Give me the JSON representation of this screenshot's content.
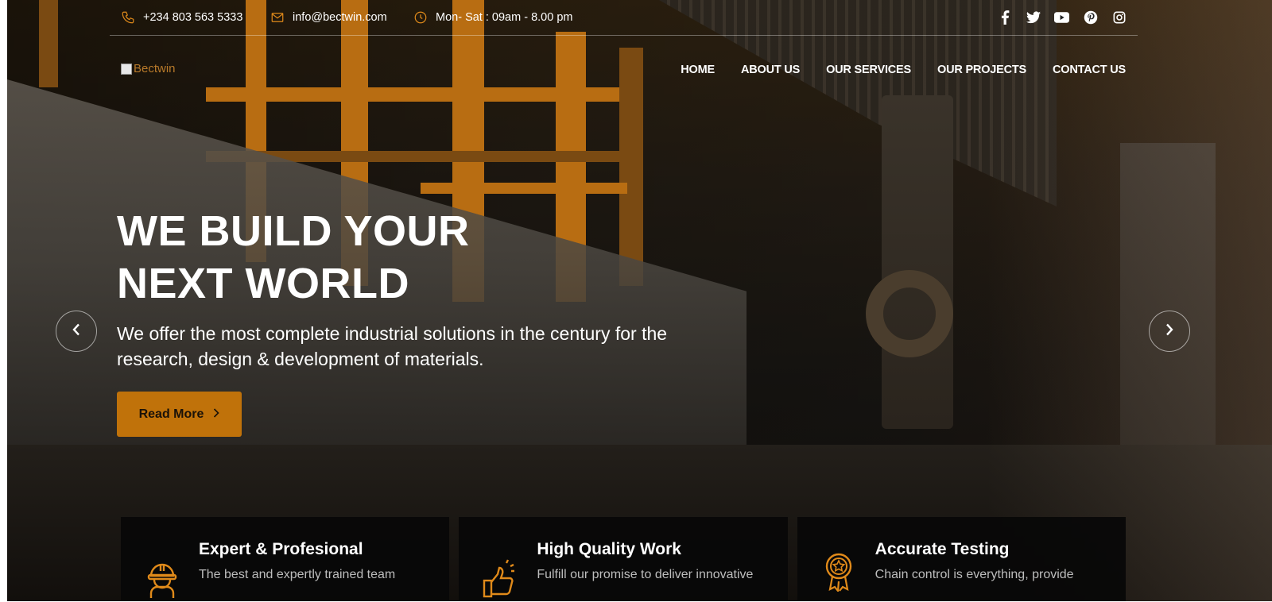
{
  "topbar": {
    "phone": "+234 803 563 5333",
    "email": "info@bectwin.com",
    "hours": "Mon- Sat : 09am - 8.00 pm",
    "icons": [
      "phone-icon",
      "mail-icon",
      "clock-icon"
    ],
    "social": [
      "facebook-icon",
      "twitter-icon",
      "youtube-icon",
      "pinterest-icon",
      "instagram-icon"
    ]
  },
  "logo": {
    "alt": "Bectwin"
  },
  "nav": {
    "items": [
      "HOME",
      "ABOUT US",
      "OUR SERVICES",
      "OUR PROJECTS",
      "CONTACT US"
    ]
  },
  "hero": {
    "headline_line1": "WE BUILD YOUR",
    "headline_line2": "NEXT WORLD",
    "subtext": "We offer the most complete industrial solutions in the century for the research, design & development of materials.",
    "cta_label": "Read More"
  },
  "features": [
    {
      "title": "Expert & Profesional",
      "desc": "The best and expertly trained team",
      "icon": "worker-helmet-icon"
    },
    {
      "title": "High Quality Work",
      "desc": "Fulfill our promise to deliver innovative",
      "icon": "thumbs-up-icon"
    },
    {
      "title": "Accurate Testing",
      "desc": "Chain control is everything, provide",
      "icon": "award-badge-icon"
    }
  ],
  "colors": {
    "accent": "#c0720a",
    "icon_orange": "#e08a1a",
    "text_white": "#ffffff"
  }
}
